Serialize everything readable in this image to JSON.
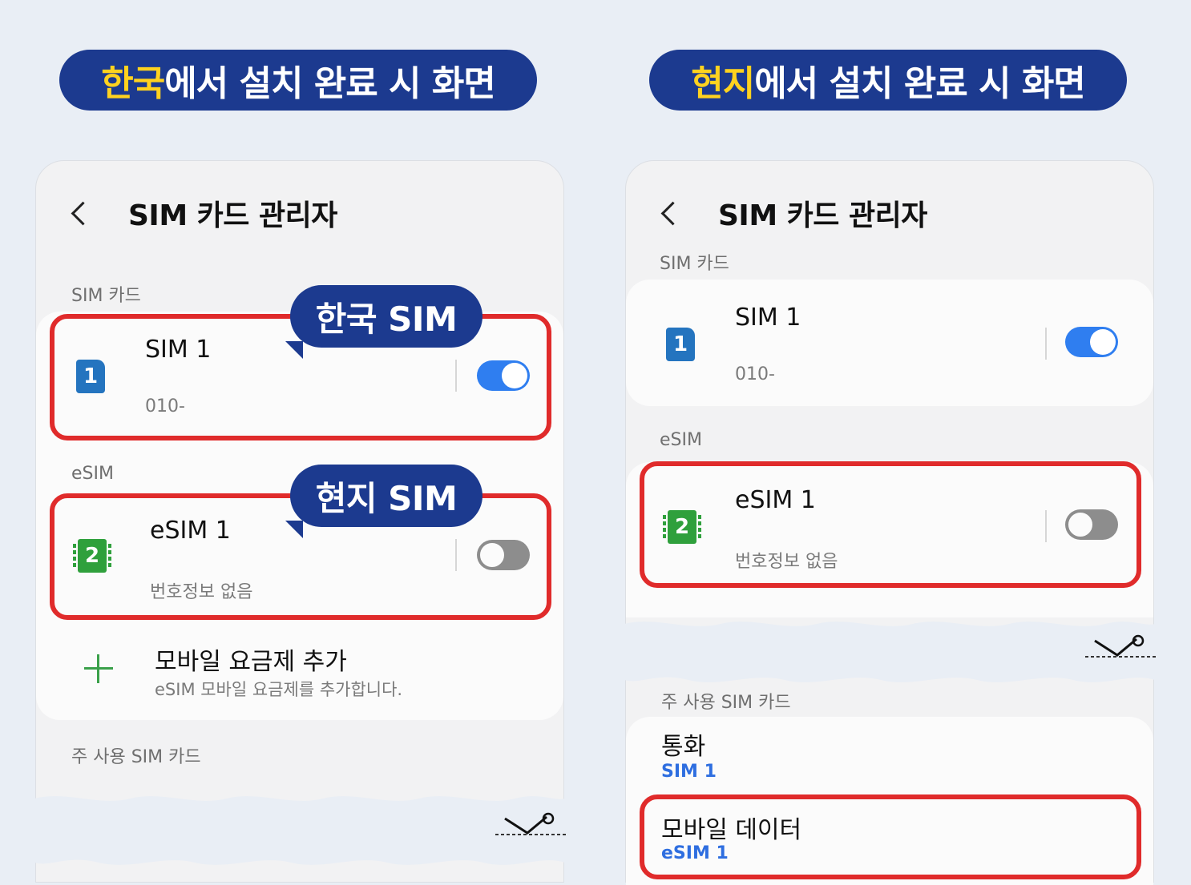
{
  "left": {
    "headline": {
      "highlight": "한국",
      "rest": "에서 설치 완료 시 화면"
    },
    "header": {
      "title": "SIM 카드 관리자"
    },
    "sim_section_label": "SIM 카드",
    "sim1": {
      "icon_number": "1",
      "name": "SIM 1",
      "number": "010-",
      "enabled": true
    },
    "sim1_callout": "한국 SIM",
    "esim_section_label": "eSIM",
    "esim1": {
      "icon_number": "2",
      "name": "eSIM 1",
      "number": "번호정보 없음",
      "enabled": false
    },
    "esim1_callout": "현지 SIM",
    "add_plan": {
      "title": "모바일 요금제 추가",
      "subtitle": "eSIM 모바일 요금제를 추가합니다."
    },
    "preferred_section_label": "주 사용 SIM 카드"
  },
  "right": {
    "headline": {
      "highlight": "현지",
      "rest": "에서 설치 완료 시 화면"
    },
    "header": {
      "title": "SIM 카드 관리자"
    },
    "sim_section_label": "SIM 카드",
    "sim1": {
      "icon_number": "1",
      "name": "SIM 1",
      "number": "010-",
      "enabled": true
    },
    "esim_section_label": "eSIM",
    "esim1": {
      "icon_number": "2",
      "name": "eSIM 1",
      "number": "번호정보 없음",
      "enabled": false
    },
    "preferred_section_label": "주 사용 SIM 카드",
    "calls": {
      "label": "통화",
      "value": "SIM 1"
    },
    "mobile_data": {
      "label": "모바일 데이터",
      "value": "eSIM 1"
    }
  },
  "colors": {
    "navy": "#1c3a8f",
    "highlight_yellow": "#ffd21f",
    "toggle_on": "#2f7ef0",
    "red_outline": "#e02b2b",
    "link_blue": "#2e6ee0"
  },
  "icons": [
    "back-chevron-icon",
    "sim-card-icon",
    "esim-chip-icon",
    "plus-icon",
    "scissors-icon"
  ]
}
